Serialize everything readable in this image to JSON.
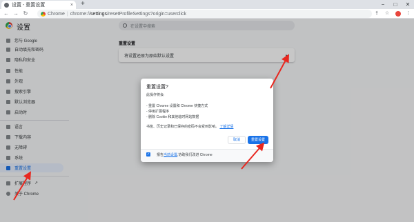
{
  "browser": {
    "tab_title": "设置 - 重置设置",
    "tab_close": "×",
    "new_tab": "+",
    "minimize": "−",
    "maximize": "□",
    "close": "✕",
    "back": "←",
    "forward": "→",
    "reload": "↻",
    "site_label": "Chrome",
    "url_prefix": "chrome://",
    "url_host": "settings",
    "url_path": "/resetProfileSettings?origin=userclick",
    "share_icon": "⇪",
    "star_icon": "☆",
    "menu_icon": "⋮",
    "accent_color": "#1a73e8"
  },
  "settings": {
    "title": "设置",
    "search_placeholder": "在设置中搜索"
  },
  "sidebar": {
    "items": [
      {
        "label": "您与 Google",
        "icon": "person-icon"
      },
      {
        "label": "自动填充和密码",
        "icon": "autofill-icon"
      },
      {
        "label": "隐私和安全",
        "icon": "shield-icon"
      },
      {
        "label": "性能",
        "icon": "performance-icon"
      },
      {
        "label": "外观",
        "icon": "palette-icon"
      },
      {
        "label": "搜索引擎",
        "icon": "search-icon"
      },
      {
        "label": "默认浏览器",
        "icon": "browser-icon"
      },
      {
        "label": "启动时",
        "icon": "power-icon"
      },
      {
        "label": "语言",
        "icon": "language-icon"
      },
      {
        "label": "下载内容",
        "icon": "download-icon"
      },
      {
        "label": "无障碍",
        "icon": "accessibility-icon"
      },
      {
        "label": "系统",
        "icon": "wrench-icon"
      },
      {
        "label": "重置设置",
        "icon": "reset-icon"
      },
      {
        "label": "扩展程序",
        "icon": "extension-icon"
      },
      {
        "label": "关于 Chrome",
        "icon": "chrome-icon"
      }
    ]
  },
  "main": {
    "section_title": "重置设置",
    "card_label": "将设置还原为原始默认设置",
    "card_arrow": "▸"
  },
  "dialog": {
    "title": "重置设置?",
    "intro": "此操作将会:",
    "bullets": [
      "- 重置 Chrome 设置和 Chrome 快捷方式",
      "- 停用扩展程序",
      "- 删除 Cookie 和其他临时网站数据"
    ],
    "note": "书签、历史记录和已保存的密码不会受到影响。",
    "learn_more": "了解详情",
    "cancel": "取消",
    "confirm": "重置设置",
    "footer_prefix": "报告",
    "footer_link": "当前设置",
    "footer_suffix": ",协助我们改进 Chrome",
    "checkbox_checked": true,
    "checkbox_mark": "✓"
  }
}
